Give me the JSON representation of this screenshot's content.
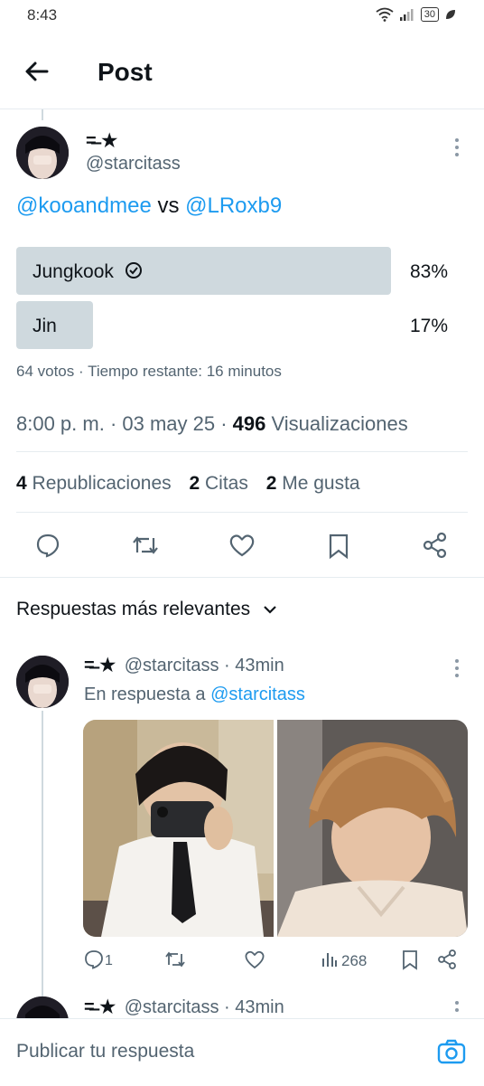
{
  "status_bar": {
    "time": "8:43",
    "battery": "30"
  },
  "header": {
    "title": "Post"
  },
  "post": {
    "display_name": "=̶ ★",
    "handle": "@starcitass",
    "text_mention_1": "@kooandmee",
    "text_vs": " vs ",
    "text_mention_2": "@LRoxb9",
    "poll": {
      "options": [
        {
          "label": "Jungkook",
          "percent": "83%",
          "fraction": 0.83,
          "winner": true
        },
        {
          "label": "Jin",
          "percent": "17%",
          "fraction": 0.17,
          "winner": false
        }
      ],
      "meta": "64 votos · Tiempo restante: 16 minutos"
    },
    "time": "8:00 p. m. · 03 may 25 · ",
    "views_count": "496",
    "views_label": " Visualizaciones",
    "stats": {
      "reposts_count": "4",
      "reposts_label": " Republicaciones",
      "quotes_count": "2",
      "quotes_label": " Citas",
      "likes_count": "2",
      "likes_label": " Me gusta"
    }
  },
  "replies_section": {
    "sort_label": "Respuestas más relevantes"
  },
  "reply1": {
    "display_name": "=̶ ★",
    "meta": "@starcitass · 43min",
    "in_reply_prefix": "En respuesta a ",
    "in_reply_handle": "@starcitass",
    "reply_count": "1",
    "views": "268"
  },
  "reply2": {
    "display_name": "=̶ ★",
    "meta": "@starcitass · 43min"
  },
  "composer": {
    "placeholder": "Publicar tu respuesta"
  },
  "colors": {
    "accent": "#1d9bf0",
    "poll_bar": "#cfd9de",
    "text": "#0f1419",
    "muted": "#536471"
  }
}
